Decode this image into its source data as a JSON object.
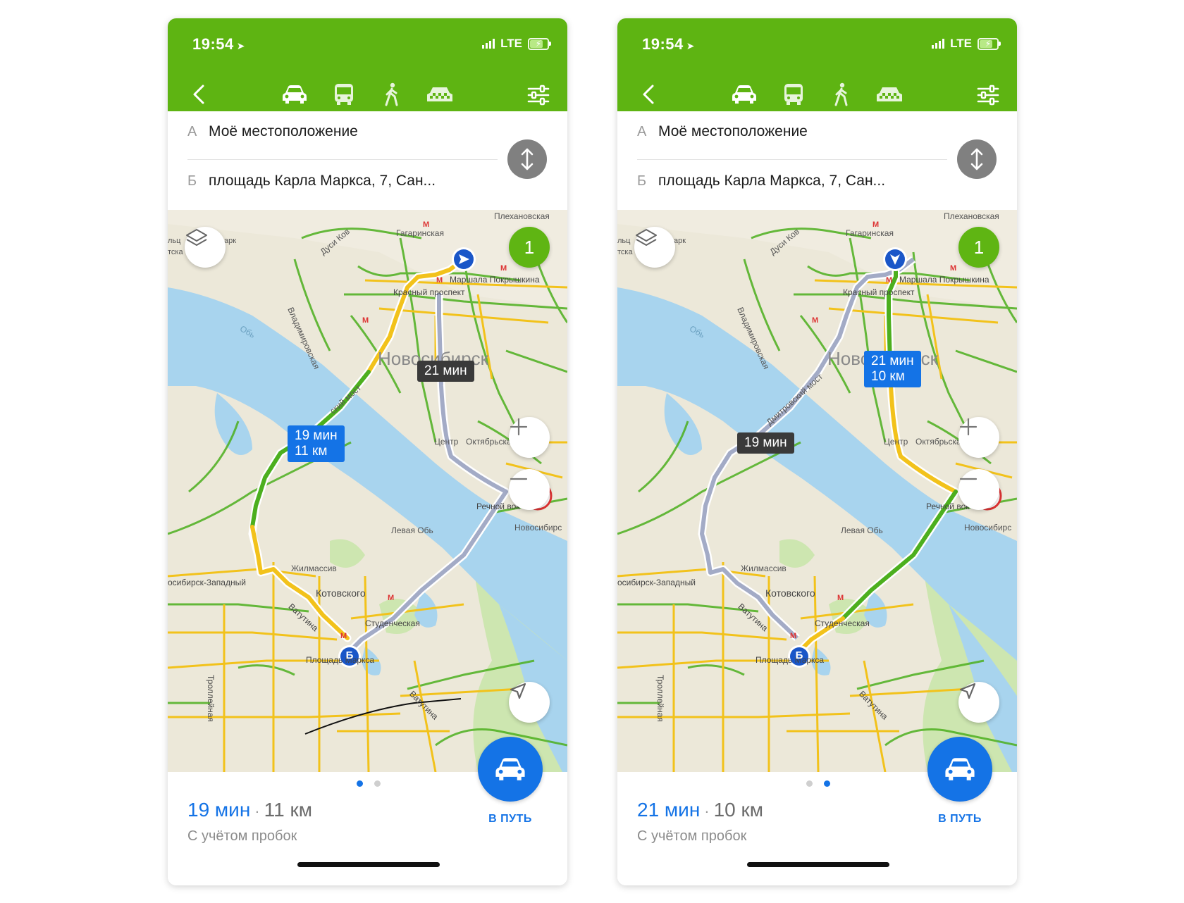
{
  "screens": [
    {
      "status": {
        "time": "19:54",
        "network": "LTE"
      },
      "route_from": {
        "letter": "А",
        "text": "Моё местоположение"
      },
      "route_to": {
        "letter": "Б",
        "text": "площадь Карла Маркса, 7, Сан..."
      },
      "map": {
        "badge": "1",
        "selected_bubble": {
          "time": "19 мин",
          "distance": "11 км"
        },
        "alt_bubble": {
          "time": "21 мин"
        },
        "end_marker": "Б",
        "labels": {
          "city": "Новосибирск",
          "river": "Обь",
          "plekhanovskaya": "Плехановская",
          "gagarinskaya": "Гагаринская",
          "dusi_kov": "Дуси Ков",
          "park": "арк",
          "marshala": "Маршала Покрышкина",
          "krasny": "Красный проспект",
          "vladimirovskaya": "Владимировская",
          "most": "ский мост",
          "tsentr": "Центр",
          "oktyabrskaya": "Октябрьская",
          "rechnoy": "Речной вок",
          "levaya_ob": "Левая Обь",
          "novosibirsk_station": "Новосибирс",
          "zhilmassiv": "Жилмассив",
          "zapadny": "осибирск-Западный",
          "kotovskogo": "Котовского",
          "vatutina": "Ватутина",
          "studencheskaya": "Студенческая",
          "ploshad": "Площадь Маркса",
          "trolleynaya": "Троллейная",
          "vatutina2": "Ватутина",
          "edge_left": "льц",
          "edge_left2": "тска"
        }
      },
      "summary": {
        "time": "19 мин",
        "separator": "·",
        "distance": "11 км",
        "note": "С учётом пробок"
      },
      "go_label": "В ПУТЬ"
    },
    {
      "status": {
        "time": "19:54",
        "network": "LTE"
      },
      "route_from": {
        "letter": "А",
        "text": "Моё местоположение"
      },
      "route_to": {
        "letter": "Б",
        "text": "площадь Карла Маркса, 7, Сан..."
      },
      "map": {
        "badge": "1",
        "selected_bubble": {
          "time": "21 мин",
          "distance": "10 км"
        },
        "alt_bubble": {
          "time": "19 мин"
        },
        "end_marker": "Б",
        "labels": {
          "city": "Новосибирск",
          "river": "Обь",
          "plekhanovskaya": "Плехановская",
          "gagarinskaya": "Гагаринская",
          "dusi_kov": "Дуси Ков",
          "park": "арк",
          "marshala": "Маршала Покрышкина",
          "krasny": "Красный проспект",
          "vladimirovskaya": "Владимировская",
          "most": "Дмитровский мост",
          "tsentr": "Центр",
          "oktyabrskaya": "Октябрьская",
          "rechnoy": "Речной вок",
          "levaya_ob": "Левая Обь",
          "novosibirsk_station": "Новосибирс",
          "zhilmassiv": "Жилмассив",
          "zapadny": "осибирск-Западный",
          "kotovskogo": "Котовского",
          "vatutina": "Ватутина",
          "studencheskaya": "Студенческая",
          "ploshad": "Площадь Маркса",
          "trolleynaya": "Троллейная",
          "vatutina2": "Ватутина",
          "edge_left": "льц",
          "edge_left2": "тска"
        }
      },
      "summary": {
        "time": "21 мин",
        "separator": "·",
        "distance": "10 км",
        "note": "С учётом пробок"
      },
      "go_label": "В ПУТЬ"
    }
  ],
  "colors": {
    "header_green": "#5eb412",
    "accent_blue": "#1473e6",
    "traffic_green": "#4caf1e",
    "traffic_yellow": "#f2c21b",
    "alt_route": "#9aa3b8",
    "water": "#a8d4ee",
    "park": "#cde6b0",
    "land": "#ece8d9"
  },
  "icons": [
    "back-icon",
    "car-icon",
    "bus-icon",
    "walk-icon",
    "taxi-icon",
    "settings-icon",
    "swap-icon",
    "layers-icon",
    "zoom-in-icon",
    "zoom-out-icon",
    "locate-icon",
    "metro-icon",
    "roadworks-icon"
  ],
  "active_page_index": [
    0,
    1
  ]
}
